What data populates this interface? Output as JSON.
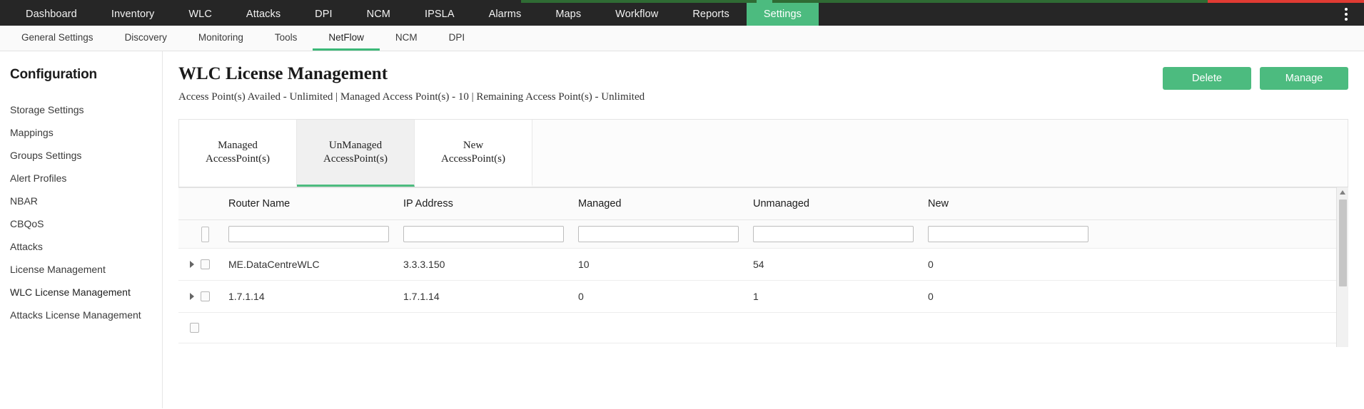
{
  "accent": {
    "dark": "#262626",
    "green_dark": "#2f6b34",
    "mint": "#4cbb7f",
    "red": "#e03b33"
  },
  "main_nav": {
    "items": [
      {
        "label": "Dashboard",
        "active": false
      },
      {
        "label": "Inventory",
        "active": false
      },
      {
        "label": "WLC",
        "active": false
      },
      {
        "label": "Attacks",
        "active": false
      },
      {
        "label": "DPI",
        "active": false
      },
      {
        "label": "NCM",
        "active": false
      },
      {
        "label": "IPSLA",
        "active": false
      },
      {
        "label": "Alarms",
        "active": false
      },
      {
        "label": "Maps",
        "active": false
      },
      {
        "label": "Workflow",
        "active": false
      },
      {
        "label": "Reports",
        "active": false
      },
      {
        "label": "Settings",
        "active": true
      }
    ],
    "overflow_icon": "kebab-menu-icon"
  },
  "sub_nav": {
    "items": [
      {
        "label": "General Settings",
        "active": false
      },
      {
        "label": "Discovery",
        "active": false
      },
      {
        "label": "Monitoring",
        "active": false
      },
      {
        "label": "Tools",
        "active": false
      },
      {
        "label": "NetFlow",
        "active": true
      },
      {
        "label": "NCM",
        "active": false
      },
      {
        "label": "DPI",
        "active": false
      }
    ]
  },
  "sidebar": {
    "title": "Configuration",
    "items": [
      {
        "label": "Storage Settings",
        "active": false
      },
      {
        "label": "Mappings",
        "active": false
      },
      {
        "label": "Groups Settings",
        "active": false
      },
      {
        "label": "Alert Profiles",
        "active": false
      },
      {
        "label": "NBAR",
        "active": false
      },
      {
        "label": "CBQoS",
        "active": false
      },
      {
        "label": "Attacks",
        "active": false
      },
      {
        "label": "License Management",
        "active": false
      },
      {
        "label": "WLC License Management",
        "active": true
      },
      {
        "label": "Attacks License Management",
        "active": false
      }
    ]
  },
  "page": {
    "title": "WLC License Management",
    "subtitle": "Access Point(s) Availed - Unlimited | Managed Access Point(s) - 10 | Remaining Access Point(s) - Unlimited",
    "delete_label": "Delete",
    "manage_label": "Manage"
  },
  "tabs": [
    {
      "line1": "Managed",
      "line2": "AccessPoint(s)",
      "active": false
    },
    {
      "line1": "UnManaged",
      "line2": "AccessPoint(s)",
      "active": true
    },
    {
      "line1": "New",
      "line2": "AccessPoint(s)",
      "active": false
    }
  ],
  "table": {
    "columns": [
      {
        "key": "ctrl",
        "label": ""
      },
      {
        "key": "router_name",
        "label": "Router Name"
      },
      {
        "key": "ip_address",
        "label": "IP Address"
      },
      {
        "key": "managed",
        "label": "Managed"
      },
      {
        "key": "unmanaged",
        "label": "Unmanaged"
      },
      {
        "key": "new",
        "label": "New"
      }
    ],
    "filters": {
      "router_name": "",
      "ip_address": "",
      "managed": "",
      "unmanaged": "",
      "new": ""
    },
    "rows": [
      {
        "router_name": "ME.DataCentreWLC",
        "ip_address": "3.3.3.150",
        "managed": "10",
        "unmanaged": "54",
        "new": "0",
        "checked": false,
        "expanded": false
      },
      {
        "router_name": "1.7.1.14",
        "ip_address": "1.7.1.14",
        "managed": "0",
        "unmanaged": "1",
        "new": "0",
        "checked": false,
        "expanded": false
      }
    ]
  }
}
